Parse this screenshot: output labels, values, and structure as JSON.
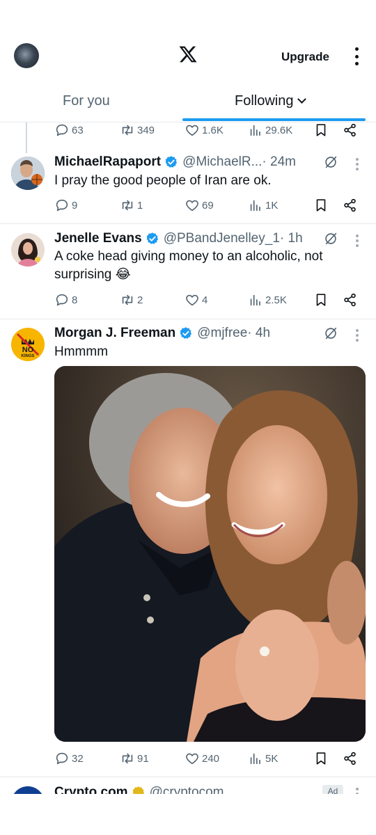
{
  "header": {
    "logo": "x-logo",
    "upgrade_label": "Upgrade",
    "menu_icon": "kebab-icon"
  },
  "tabs": [
    {
      "label": "For you",
      "active": false
    },
    {
      "label": "Following",
      "active": true
    }
  ],
  "colors": {
    "accent": "#1d9bf0",
    "text_primary": "#0f1419",
    "text_secondary": "#536471",
    "divider": "#e6e9ec"
  },
  "prev_tweet_actions": {
    "replies": "63",
    "reposts": "349",
    "likes": "1.6K",
    "views": "29.6K"
  },
  "tweets": [
    {
      "name": "MichaelRapaport",
      "verified": true,
      "handle": "@MichaelR...",
      "time": " · 24m",
      "text": "I pray the good people of Iran are ok.",
      "replies": "9",
      "reposts": "1",
      "likes": "69",
      "views": "1K"
    },
    {
      "name": "Jenelle Evans",
      "verified": true,
      "handle": "@PBandJenelley_1",
      "time": " · 1h",
      "text": "A coke head giving money to an alcoholic, not surprising 😂",
      "replies": "8",
      "reposts": "2",
      "likes": "4",
      "views": "2.5K"
    },
    {
      "name": "Morgan J. Freeman",
      "verified": true,
      "handle": "@mjfree",
      "time": " · 4h",
      "text": "Hmmmm",
      "avatar_text": [
        "NO",
        "KINGS"
      ],
      "replies": "32",
      "reposts": "91",
      "likes": "240",
      "views": "5K",
      "media": "photo of a smiling man and woman embracing"
    }
  ],
  "next_tweet": {
    "name": "Crypto.com",
    "handle": "@cryptocom",
    "ad_label": "Ad"
  }
}
